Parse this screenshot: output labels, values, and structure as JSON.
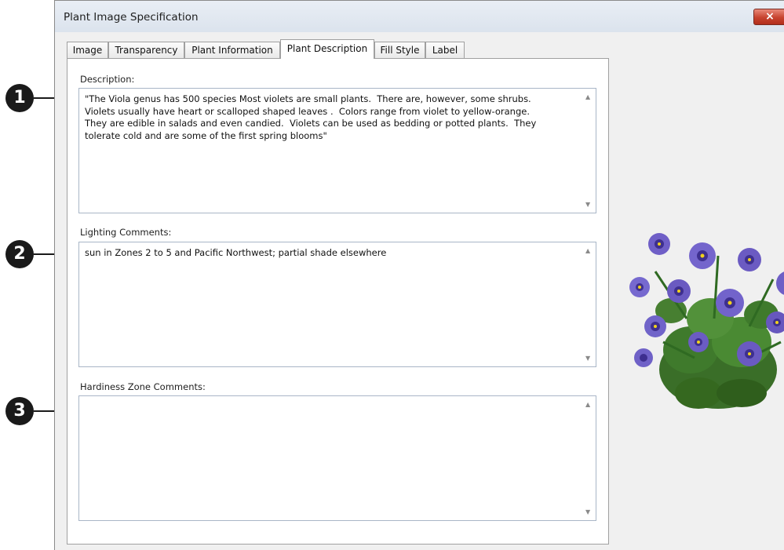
{
  "window": {
    "title": "Plant Image Specification",
    "close_glyph": "×"
  },
  "tabs": [
    {
      "label": "Image",
      "active": false
    },
    {
      "label": "Transparency",
      "active": false
    },
    {
      "label": "Plant Information",
      "active": false
    },
    {
      "label": "Plant Description",
      "active": true
    },
    {
      "label": "Fill Style",
      "active": false
    },
    {
      "label": "Label",
      "active": false
    }
  ],
  "callouts": [
    "1",
    "2",
    "3"
  ],
  "fields": {
    "description": {
      "label": "Description:",
      "value": "\"The Viola genus has 500 species Most violets are small plants.  There are, however, some shrubs.\nViolets usually have heart or scalloped shaped leaves .  Colors range from violet to yellow-orange.\nThey are edible in salads and even candied.  Violets can be used as bedding or potted plants.  They\ntolerate cold and are some of the first spring blooms\""
    },
    "lighting": {
      "label": "Lighting Comments:",
      "value": "sun in Zones 2 to 5 and Pacific Northwest; partial shade elsewhere"
    },
    "hardiness": {
      "label": "Hardiness Zone Comments:",
      "value": ""
    }
  },
  "scroll_glyphs": {
    "up": "▲",
    "down": "▼"
  },
  "colors": {
    "flower": "#6f5fc7",
    "flower_dark": "#3e2f8f",
    "leaf": "#3f7a2c",
    "close_button": "#c7432f"
  }
}
